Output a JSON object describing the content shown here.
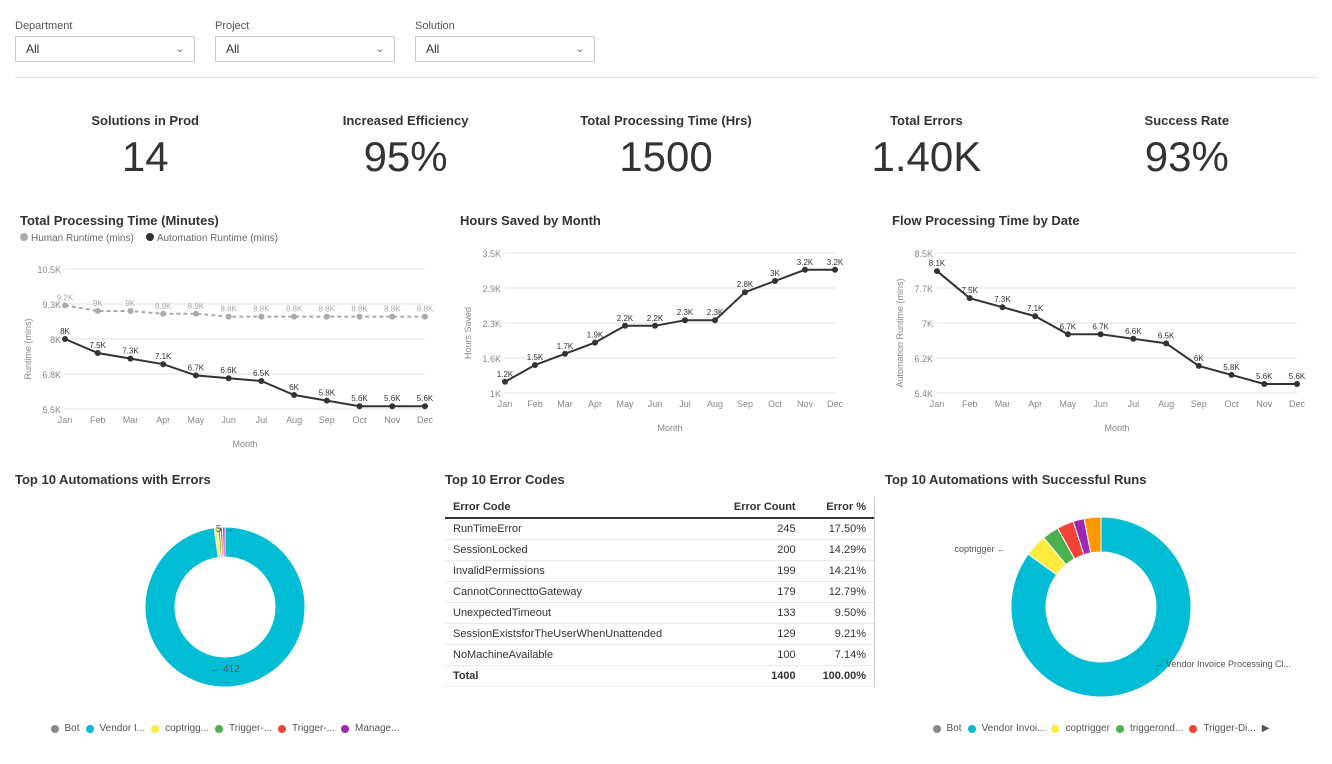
{
  "filters": {
    "department": {
      "label": "Department",
      "value": "All"
    },
    "project": {
      "label": "Project",
      "value": "All"
    },
    "solution": {
      "label": "Solution",
      "value": "All"
    }
  },
  "kpis": [
    {
      "id": "solutions-in-prod",
      "title": "Solutions in Prod",
      "value": "14"
    },
    {
      "id": "increased-efficiency",
      "title": "Increased Efficiency",
      "value": "95%"
    },
    {
      "id": "total-processing-time",
      "title": "Total Processing Time (Hrs)",
      "value": "1500"
    },
    {
      "id": "total-errors",
      "title": "Total Errors",
      "value": "1.40K"
    },
    {
      "id": "success-rate",
      "title": "Success Rate",
      "value": "93%"
    }
  ],
  "charts": {
    "processing_time": {
      "title": "Total Processing Time (Minutes)",
      "legend": [
        "Human Runtime (mins)",
        "Automation Runtime (mins)"
      ],
      "x_label": "Month",
      "y_label": "Runtime (mins)",
      "months": [
        "Jan",
        "Feb",
        "Mar",
        "Apr",
        "May",
        "Jun",
        "Jul",
        "Aug",
        "Sep",
        "Oct",
        "Nov",
        "Dec"
      ],
      "human": [
        9200,
        9000,
        9000,
        8900,
        8900,
        8800,
        8800,
        8800,
        8800,
        8800,
        8800,
        8800
      ],
      "automation": [
        8000,
        7500,
        7300,
        7100,
        6700,
        6600,
        6500,
        6000,
        5800,
        5600,
        5600,
        5600
      ]
    },
    "hours_saved": {
      "title": "Hours Saved by Month",
      "x_label": "Month",
      "y_label": "Hours Saved",
      "months": [
        "Jan",
        "Feb",
        "Mar",
        "Apr",
        "May",
        "Jun",
        "Jul",
        "Aug",
        "Sep",
        "Oct",
        "Nov",
        "Dec"
      ],
      "values": [
        1200,
        1500,
        1700,
        1900,
        2200,
        2200,
        2300,
        2300,
        2800,
        3000,
        3200,
        3200
      ]
    },
    "flow_processing": {
      "title": "Flow Processing Time by Date",
      "x_label": "Month",
      "y_label": "Automation Runtime (mins)",
      "months": [
        "Jan",
        "Feb",
        "Mar",
        "Apr",
        "May",
        "Jun",
        "Jul",
        "Aug",
        "Sep",
        "Oct",
        "Nov",
        "Dec"
      ],
      "values": [
        8100,
        7500,
        7300,
        7100,
        6700,
        6700,
        6600,
        6500,
        6000,
        5800,
        5600,
        5600
      ]
    }
  },
  "error_codes": {
    "title": "Top 10 Error Codes",
    "columns": [
      "Error Code",
      "Error Count",
      "Error %"
    ],
    "rows": [
      {
        "code": "RunTimeError",
        "count": "245",
        "pct": "17.50%"
      },
      {
        "code": "SessionLocked",
        "count": "200",
        "pct": "14.29%"
      },
      {
        "code": "InvalidPermissions",
        "count": "199",
        "pct": "14.21%"
      },
      {
        "code": "CannotConnecttoGateway",
        "count": "179",
        "pct": "12.79%"
      },
      {
        "code": "UnexpectedTimeout",
        "count": "133",
        "pct": "9.50%"
      },
      {
        "code": "SessionExistsforTheUserWhenUnattended",
        "count": "129",
        "pct": "9.21%"
      },
      {
        "code": "NoMachineAvailable",
        "count": "100",
        "pct": "7.14%"
      }
    ],
    "total_count": "1400",
    "total_pct": "100.00%"
  },
  "top10_errors": {
    "title": "Top 10 Automations with Errors",
    "values": [
      {
        "label": "412",
        "angle": 340,
        "color": "#00BCD4"
      },
      {
        "label": "5",
        "angle": 20,
        "color": "#FFC107"
      }
    ],
    "legend": [
      {
        "label": "Bot",
        "color": "#888"
      },
      {
        "label": "Vendor I...",
        "color": "#00BCD4"
      },
      {
        "label": "coptrigg...",
        "color": "#FFEB3B"
      },
      {
        "label": "Trigger-...",
        "color": "#4CAF50"
      },
      {
        "label": "Trigger-...",
        "color": "#F44336"
      },
      {
        "label": "Manage...",
        "color": "#9C27B0"
      }
    ]
  },
  "top10_success": {
    "title": "Top 10 Automations with Successful Runs",
    "annotation": "coptrigger",
    "annotation2": "Vendor Invoice Processing Cl...",
    "legend": [
      {
        "label": "Bot",
        "color": "#888"
      },
      {
        "label": "Vendor Invoi...",
        "color": "#00BCD4"
      },
      {
        "label": "coptrigger",
        "color": "#FFEB3B"
      },
      {
        "label": "triggerond...",
        "color": "#4CAF50"
      },
      {
        "label": "Trigger-Di...",
        "color": "#F44336"
      }
    ]
  }
}
